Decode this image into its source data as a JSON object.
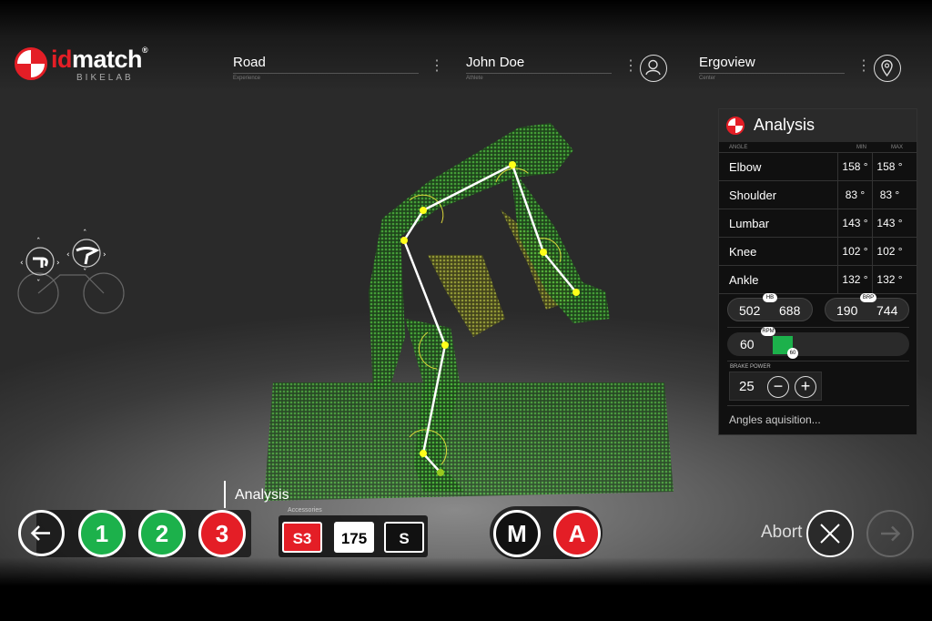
{
  "header": {
    "logo": {
      "brand_a": "id",
      "brand_b": "match",
      "reg": "®",
      "sub": "BIKELAB"
    },
    "fields": [
      {
        "value": "Road",
        "caption": "Experience"
      },
      {
        "value": "John Doe",
        "caption": "Athlete"
      },
      {
        "value": "Ergoview",
        "caption": "Center"
      }
    ],
    "icons": [
      "user-icon",
      "location-pin-icon"
    ]
  },
  "panel": {
    "title": "Analysis",
    "columns": {
      "angle": "ANGLE",
      "min": "MIN",
      "max": "MAX"
    },
    "rows": [
      {
        "name": "Elbow",
        "min": "158 °",
        "max": "158 °"
      },
      {
        "name": "Shoulder",
        "min": "83 °",
        "max": "83 °"
      },
      {
        "name": "Lumbar",
        "min": "143 °",
        "max": "143 °"
      },
      {
        "name": "Knee",
        "min": "102 °",
        "max": "102 °"
      },
      {
        "name": "Ankle",
        "min": "132 °",
        "max": "132 °"
      }
    ],
    "hb": {
      "tag": "HB",
      "a": "502",
      "b": "688"
    },
    "brp": {
      "tag": "BRP",
      "a": "190",
      "b": "744"
    },
    "rpm": {
      "tag": "RPM",
      "value": "60",
      "knob": "60",
      "fill_fraction": 0.09
    },
    "brake_power": {
      "label": "BRAKE POWER",
      "value": "25",
      "minus": "−",
      "plus": "+"
    },
    "status": "Angles aquisition..."
  },
  "bottom": {
    "step_label": "Analysis",
    "steps": [
      "1",
      "2",
      "3"
    ],
    "step_colors": {
      "done": "#1cb14b",
      "current": "#e41e26"
    },
    "accessories_title": "Accessories",
    "accessories": [
      {
        "label": "S3",
        "bg": "#e41e26",
        "fg": "#ffffff"
      },
      {
        "label": "175",
        "bg": "#ffffff",
        "fg": "#000000"
      },
      {
        "label": "S",
        "bg": "#111111",
        "fg": "#ffffff"
      }
    ],
    "modes": {
      "manual": "M",
      "auto": "A"
    },
    "abort_label": "Abort"
  }
}
